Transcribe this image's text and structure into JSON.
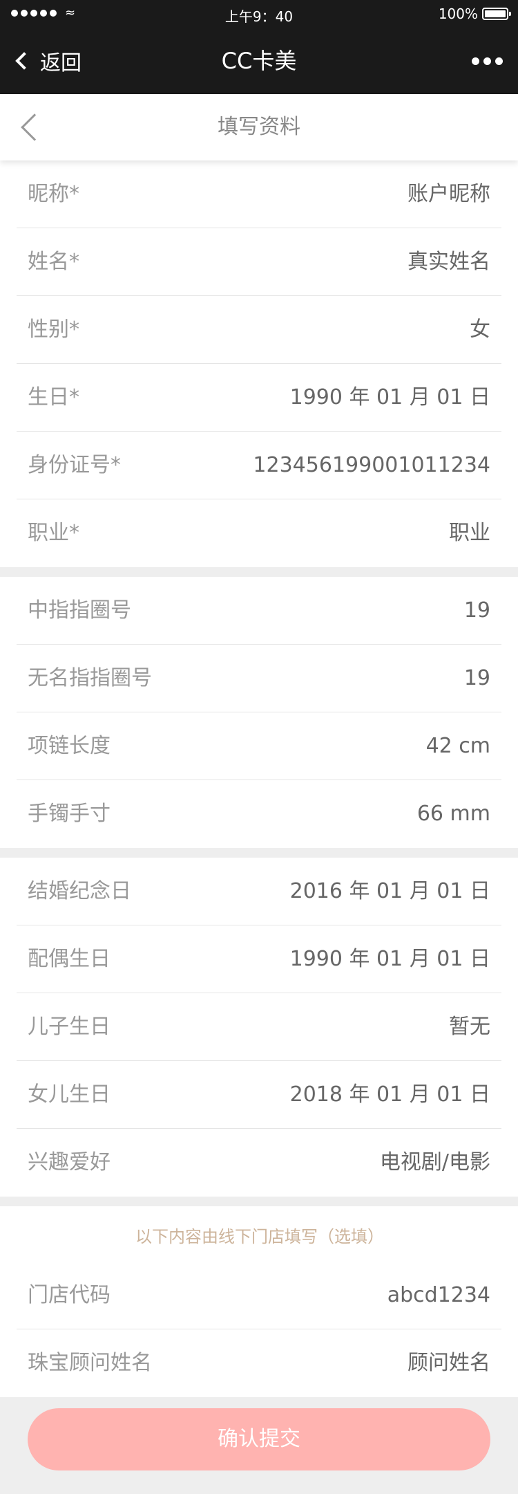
{
  "status_bar": {
    "time": "上午9：40",
    "battery": "100%"
  },
  "nav": {
    "back_label": "返回",
    "title": "CC卡美"
  },
  "header": {
    "title": "填写资料"
  },
  "section1": [
    {
      "label": "昵称*",
      "value": "账户昵称"
    },
    {
      "label": "姓名*",
      "value": "真实姓名"
    },
    {
      "label": "性别*",
      "value": "女"
    },
    {
      "label": "生日*",
      "value": "1990 年 01 月 01 日"
    },
    {
      "label": "身份证号*",
      "value": "12345619900101123­4"
    },
    {
      "label": "职业*",
      "value": "职业"
    }
  ],
  "section2": [
    {
      "label": "中指指圈号",
      "value": "19"
    },
    {
      "label": "无名指指圈号",
      "value": "19"
    },
    {
      "label": "项链长度",
      "value": "42 cm"
    },
    {
      "label": "手镯手寸",
      "value": "66 mm"
    }
  ],
  "section3": [
    {
      "label": "结婚纪念日",
      "value": "2016 年 01 月 01 日"
    },
    {
      "label": "配偶生日",
      "value": "1990 年 01 月 01 日"
    },
    {
      "label": "儿子生日",
      "value": "暂无"
    },
    {
      "label": "女儿生日",
      "value": "2018 年 01 月 01 日"
    },
    {
      "label": "兴趣爱好",
      "value": "电视剧/电影"
    }
  ],
  "section4": {
    "hint": "以下内容由线下门店填写（选填）",
    "rows": [
      {
        "label": "门店代码",
        "value": "abcd1234"
      },
      {
        "label": "珠宝顾问姓名",
        "value": "顾问姓名"
      }
    ]
  },
  "submit_label": "确认提交",
  "colors": {
    "label": "#999999",
    "value": "#666666",
    "hint": "#CDB49B",
    "button": "#ffb3b0"
  }
}
